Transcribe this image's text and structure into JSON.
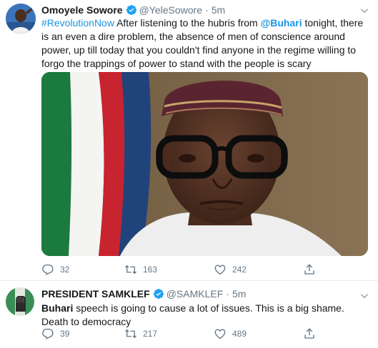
{
  "tweets": [
    {
      "author_name": "Omoyele Sowore",
      "handle": "@YeleSowore",
      "separator": "·",
      "time": "5m",
      "text_parts": {
        "hashtag": "#RevolutionNow",
        "t1": " After listening to the hubris from ",
        "mention": "@Buhari",
        "t2": " tonight, there is an even a dire problem, the absence of men of conscience around power, up till today that you couldn't find anyone in the regime willing to forgo the trappings of power to stand with the people is scary"
      },
      "has_media": true,
      "replies": "32",
      "retweets": "163",
      "likes": "242"
    },
    {
      "author_name": "PRESIDENT SAMKLEF",
      "handle": "@SAMKLEF",
      "separator": "·",
      "time": "5m",
      "text_parts": {
        "bold": "Buhari",
        "t1": " speech is going to cause a lot of issues. This is  a big shame.   Death to democracy"
      },
      "has_media": false,
      "replies": "39",
      "retweets": "217",
      "likes": "489"
    }
  ],
  "icons": {
    "verified": "verified-badge-icon",
    "more": "chevron-down-icon",
    "reply": "reply-icon",
    "retweet": "retweet-icon",
    "like": "heart-icon",
    "share": "share-icon"
  },
  "colors": {
    "link": "#1b95e0",
    "verified": "#1da1f2",
    "muted": "#657786",
    "divider": "#e6ecf0"
  }
}
